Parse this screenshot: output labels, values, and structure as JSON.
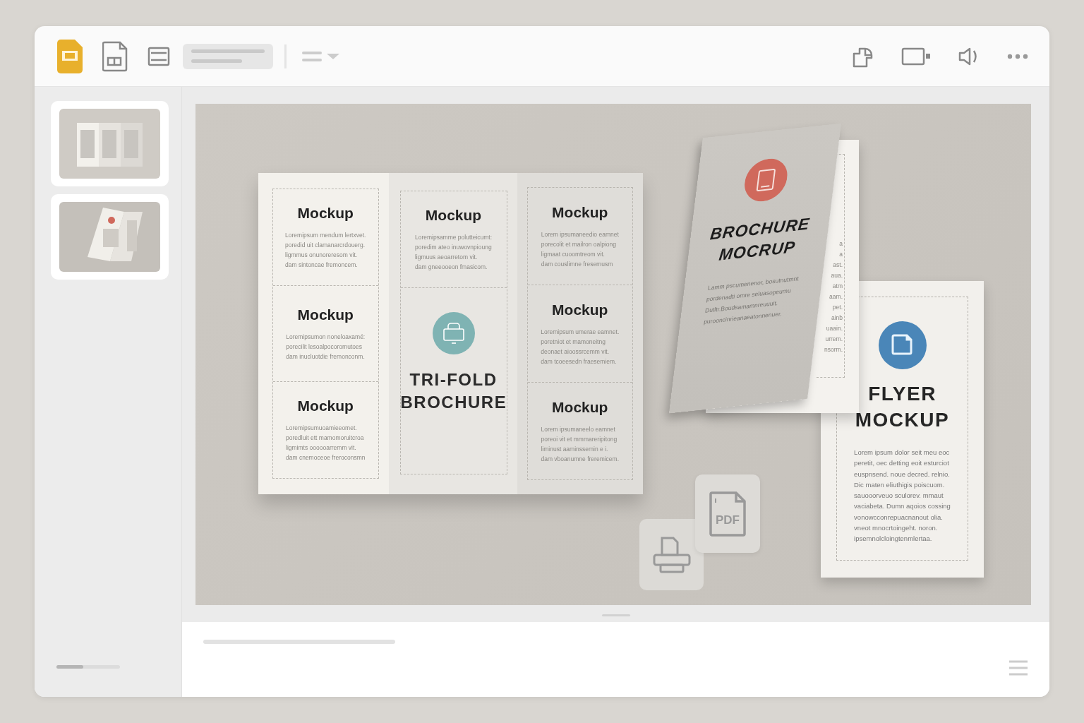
{
  "sidebar": {
    "progress": {
      "level": 0.42
    }
  },
  "slide": {
    "trifold": {
      "panels": [
        {
          "sections": [
            {
              "heading": "Mockup",
              "lines": [
                "Loremipsum mendum lertxvet.",
                "poredid uit clamanarcrdouerg.",
                "ligmmus onunoreresom vit.",
                "dam sintoncae fremoncem."
              ]
            },
            {
              "heading": "Mockup",
              "lines": [
                "Loremipsumon noneloaxamé:",
                "porecilit lesoalpocoromutoes",
                "dam inucluotdie fremonconm."
              ]
            },
            {
              "heading": "Mockup",
              "lines": [
                "Loremipsumuoamieeomet.",
                "poredluit ett mamomoruitcroa",
                "ligmimts oooooarremm vit.",
                "dam cnemoceoe freroconsmn"
              ]
            }
          ]
        },
        {
          "sections": [
            {
              "heading": "Mockup",
              "lines": [
                "Loremipsamme polutteicumt:",
                "poredim ateo inuwovnpioung",
                "ligmuus aeoarretom vit.",
                "dam gneeooeon fmasicom."
              ]
            }
          ],
          "title": "TRI-FOLD BROCHURE"
        },
        {
          "sections": [
            {
              "heading": "Mockup",
              "lines": [
                "Lorem ipsumaneedio eamnet",
                "porecolit et mailron oalpiong",
                "ligmaat cuoomtreom vit.",
                "dam couslimne fresemusm"
              ]
            },
            {
              "heading": "Mockup",
              "lines": [
                "Loremipsum umerae eamnet.",
                "poretniot et mamoneitng",
                "deonaet aioossrcemm vit.",
                "dam tcoeesedn fraesemiem."
              ]
            },
            {
              "heading": "Mockup",
              "lines": [
                "Lorem ipsumaneelo eamnet",
                "poreoi vit et mmmareripitong",
                "liminust aaminssemin e i.",
                "dam vboanumne freremicem."
              ]
            }
          ]
        }
      ]
    },
    "brochure": {
      "back_fragments": [
        "a",
        "a",
        "ast.",
        "aua.",
        "atm",
        "aam.",
        "pet.",
        "ainb",
        "uaain.",
        "urrem.",
        "nsorm."
      ],
      "title": "BROCHURE MOCRUP",
      "lines": [
        "Lamm pscumenenor, bosutnutmnt",
        "pordenadti omre seluasopeumu",
        "Dutltr.Boudsamamnreuuuit.",
        "purooncinrieanaeatonnenuer."
      ]
    },
    "flyer": {
      "title": "FLYER MOCKUP",
      "lines": [
        "Lorem ipsum dolor seit meu eoc",
        "peretit, oec detting eoit esturciot",
        "euspnsend. noue decred. relnio.",
        "Dic maten eliuthigis poiscuom.",
        "sauooorveuo sculorev. mmaut",
        "vaciabeta. Dumn aqoios cossing",
        "vonowcconrepuacnanout olia.",
        "vneot mnocrtoingeht. noron.",
        "ipsemnolcloingtenmlertaa."
      ]
    },
    "file_tiles": [
      {
        "kind": "print"
      },
      {
        "kind": "pdf",
        "label": "PDF"
      }
    ]
  }
}
